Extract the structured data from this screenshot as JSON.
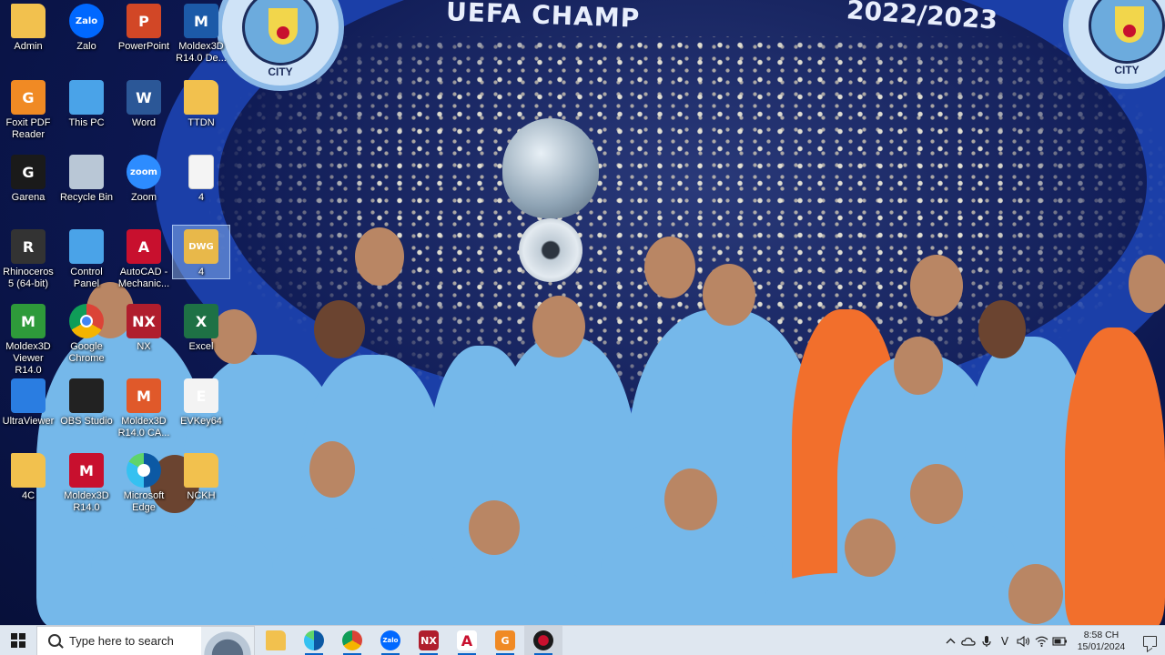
{
  "wallpaper": {
    "banner_text_left": "UEFA CHAMP",
    "banner_text_right": "2022/2023",
    "crest_text": "CITY",
    "colors": {
      "sky_blue": "#6cabdd",
      "navy": "#0c1750",
      "arch_blue": "#1b3fa8"
    }
  },
  "desktop": {
    "icons": [
      {
        "label": "Admin",
        "icon": "user-folder-icon",
        "color": "#f2c14e",
        "glyph": ""
      },
      {
        "label": "Zalo",
        "icon": "zalo-icon",
        "color": "#0068ff",
        "glyph": "Zalo"
      },
      {
        "label": "PowerPoint",
        "icon": "powerpoint-icon",
        "color": "#d24726",
        "glyph": "P"
      },
      {
        "label": "Moldex3D R14.0 De...",
        "icon": "moldex3d-designer-icon",
        "color": "#1c5aa8",
        "glyph": "M"
      },
      {
        "label": "Foxit PDF Reader",
        "icon": "foxit-pdf-icon",
        "color": "#f08a24",
        "glyph": "G"
      },
      {
        "label": "This PC",
        "icon": "this-pc-icon",
        "color": "#4aa3e8",
        "glyph": ""
      },
      {
        "label": "Word",
        "icon": "word-icon",
        "color": "#2b5797",
        "glyph": "W"
      },
      {
        "label": "TTDN",
        "icon": "folder-icon",
        "color": "#f2c14e",
        "glyph": ""
      },
      {
        "label": "Garena",
        "icon": "garena-icon",
        "color": "#1a1a1a",
        "glyph": "G"
      },
      {
        "label": "Recycle Bin",
        "icon": "recycle-bin-icon",
        "color": "#b9c7d6",
        "glyph": ""
      },
      {
        "label": "Zoom",
        "icon": "zoom-icon",
        "color": "#2d8cff",
        "glyph": "zoom"
      },
      {
        "label": "4",
        "icon": "blank-file-icon",
        "color": "#f4f4f4",
        "glyph": ""
      },
      {
        "label": "Rhinoceros 5 (64-bit)",
        "icon": "rhinoceros-icon",
        "color": "#333333",
        "glyph": "R"
      },
      {
        "label": "Control Panel",
        "icon": "control-panel-icon",
        "color": "#4aa3e8",
        "glyph": ""
      },
      {
        "label": "AutoCAD - Mechanic...",
        "icon": "autocad-icon",
        "color": "#c8102e",
        "glyph": "A"
      },
      {
        "label": "4",
        "icon": "dwg-file-icon",
        "color": "#e8b84a",
        "glyph": "DWG"
      },
      {
        "label": "Moldex3D Viewer R14.0",
        "icon": "moldex3d-viewer-icon",
        "color": "#2e9a3a",
        "glyph": "M"
      },
      {
        "label": "Google Chrome",
        "icon": "chrome-icon",
        "color": "#ffffff",
        "glyph": ""
      },
      {
        "label": "NX",
        "icon": "nx-icon",
        "color": "#b01e2d",
        "glyph": "NX"
      },
      {
        "label": "Excel",
        "icon": "excel-icon",
        "color": "#1e7145",
        "glyph": "X"
      },
      {
        "label": "UltraViewer",
        "icon": "ultraviewer-icon",
        "color": "#2a7de1",
        "glyph": ""
      },
      {
        "label": "OBS Studio",
        "icon": "obs-icon",
        "color": "#222222",
        "glyph": ""
      },
      {
        "label": "Moldex3D R14.0 CA...",
        "icon": "moldex3d-cad-icon",
        "color": "#e0592a",
        "glyph": "M"
      },
      {
        "label": "EVKey64",
        "icon": "evkey-icon",
        "color": "#f3f3f3",
        "glyph": "E"
      },
      {
        "label": "4C",
        "icon": "folder-icon",
        "color": "#f2c14e",
        "glyph": ""
      },
      {
        "label": "Moldex3D R14.0",
        "icon": "moldex3d-icon",
        "color": "#c8102e",
        "glyph": "M"
      },
      {
        "label": "Microsoft Edge",
        "icon": "edge-icon",
        "color": "#1e88c8",
        "glyph": ""
      },
      {
        "label": "NCKH",
        "icon": "folder-icon",
        "color": "#f2c14e",
        "glyph": ""
      }
    ]
  },
  "taskbar": {
    "search_placeholder": "Type here to search",
    "apps": [
      {
        "name": "file-explorer",
        "icon": "file-explorer-icon",
        "color": "#f2c14e",
        "glyph": ""
      },
      {
        "name": "edge",
        "icon": "edge-icon",
        "color": "#1e88c8",
        "glyph": ""
      },
      {
        "name": "chrome",
        "icon": "chrome-icon",
        "color": "#ffffff",
        "glyph": ""
      },
      {
        "name": "zalo",
        "icon": "zalo-icon",
        "color": "#0068ff",
        "glyph": "Zalo"
      },
      {
        "name": "nx",
        "icon": "nx-icon",
        "color": "#b01e2d",
        "glyph": "NX"
      },
      {
        "name": "autocad",
        "icon": "autocad-icon",
        "color": "#ffffff",
        "glyph": "A"
      },
      {
        "name": "foxit",
        "icon": "foxit-pdf-icon",
        "color": "#f08a24",
        "glyph": "G"
      },
      {
        "name": "garena",
        "icon": "garena-icon",
        "color": "#ffffff",
        "glyph": ""
      }
    ],
    "tray": {
      "icons": [
        "chevron-up-icon",
        "onedrive-icon",
        "microphone-icon",
        "ime-icon",
        "volume-icon",
        "network-icon",
        "battery-icon"
      ],
      "ime_text": "V",
      "time": "8:58 CH",
      "date": "15/01/2024"
    }
  }
}
